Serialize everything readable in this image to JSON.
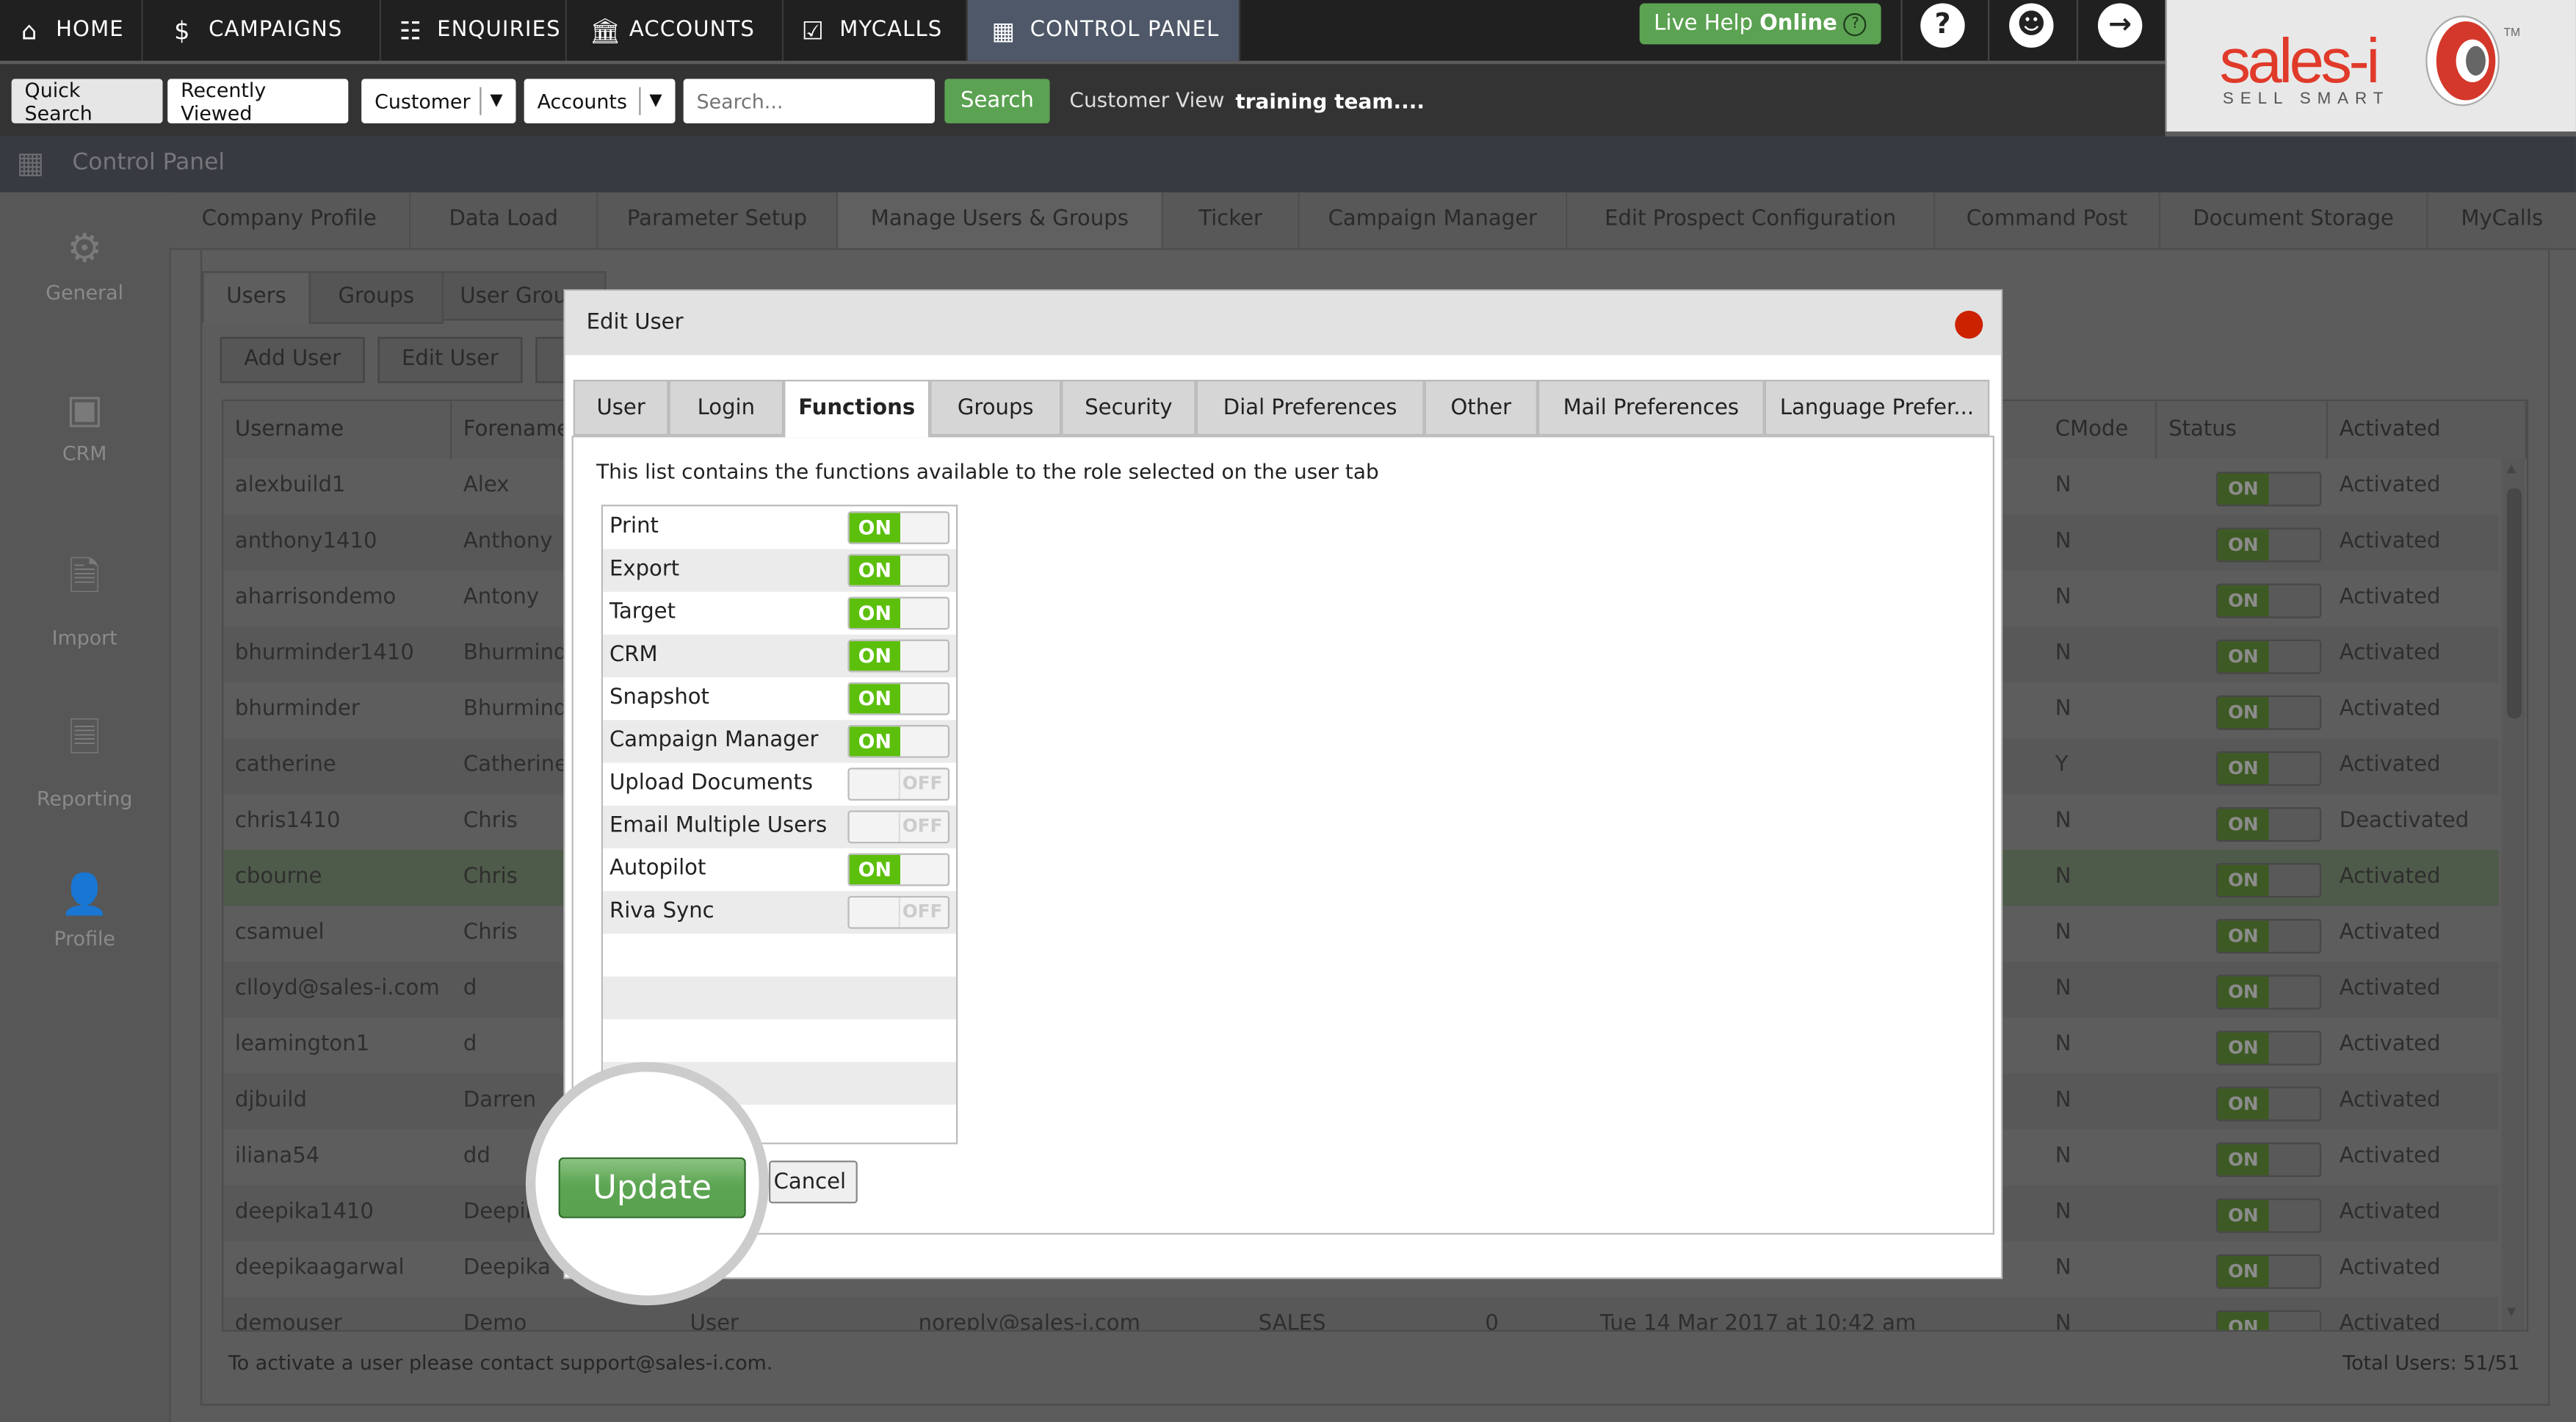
{
  "topnav": {
    "items": [
      {
        "label": "HOME",
        "icon": "home-icon"
      },
      {
        "label": "CAMPAIGNS",
        "icon": "campaigns-icon"
      },
      {
        "label": "ENQUIRIES",
        "icon": "enquiries-icon"
      },
      {
        "label": "ACCOUNTS",
        "icon": "accounts-icon"
      },
      {
        "label": "MYCALLS",
        "icon": "mycalls-icon"
      },
      {
        "label": "CONTROL PANEL",
        "icon": "control-panel-icon",
        "active": true
      }
    ],
    "live_help": "Live Help",
    "live_help_status": "Online",
    "logo_text": "sales-i",
    "logo_tagline": "SELL SMART",
    "logo_tm": "TM"
  },
  "searchbar": {
    "quick_search": "Quick Search",
    "recently_viewed": "Recently Viewed",
    "type_select": "Customer",
    "field_select": "Accounts",
    "search_placeholder": "Search...",
    "search_button": "Search",
    "customer_view_label": "Customer View",
    "customer_view_value": "training team...."
  },
  "page_title": "Control Panel",
  "sidebar": {
    "items": [
      {
        "label": "General",
        "icon": "gear-icon"
      },
      {
        "label": "CRM",
        "icon": "crm-icon"
      },
      {
        "label": "Import",
        "icon": "import-icon"
      },
      {
        "label": "Reporting",
        "icon": "reporting-icon"
      },
      {
        "label": "Profile",
        "icon": "profile-icon"
      }
    ]
  },
  "panel_tabs": [
    "Company Profile",
    "Data Load",
    "Parameter Setup",
    "Manage Users & Groups",
    "Ticker",
    "Campaign Manager",
    "Edit Prospect Configuration",
    "Command Post",
    "Document Storage",
    "MyCalls"
  ],
  "sub_tabs": [
    "Users",
    "Groups",
    "User Grou"
  ],
  "actions": {
    "add_user": "Add User",
    "edit_user": "Edit User"
  },
  "table": {
    "headers": {
      "username": "Username",
      "forename": "Forename",
      "cmode": "CMode",
      "status": "Status",
      "activated": "Activated"
    },
    "rows": [
      {
        "username": "alexbuild1",
        "forename": "Alex",
        "cmode": "N",
        "status": "ON",
        "activated": "Activated"
      },
      {
        "username": "anthony1410",
        "forename": "Anthony",
        "cmode": "N",
        "status": "ON",
        "activated": "Activated"
      },
      {
        "username": "aharrisondemo",
        "forename": "Antony",
        "cmode": "N",
        "status": "ON",
        "activated": "Activated"
      },
      {
        "username": "bhurminder1410",
        "forename": "Bhurminder",
        "cmode": "N",
        "status": "ON",
        "activated": "Activated"
      },
      {
        "username": "bhurminder",
        "forename": "Bhurminder",
        "cmode": "N",
        "status": "ON",
        "activated": "Activated"
      },
      {
        "username": "catherine",
        "forename": "Catherine",
        "cmode": "Y",
        "status": "ON",
        "activated": "Activated"
      },
      {
        "username": "chris1410",
        "forename": "Chris",
        "cmode": "N",
        "status": "ON",
        "activated": "Deactivated"
      },
      {
        "username": "cbourne",
        "forename": "Chris",
        "cmode": "N",
        "status": "ON",
        "activated": "Activated",
        "selected": true
      },
      {
        "username": "csamuel",
        "forename": "Chris",
        "cmode": "N",
        "status": "ON",
        "activated": "Activated"
      },
      {
        "username": "clloyd@sales-i.com",
        "forename": "d",
        "cmode": "N",
        "status": "ON",
        "activated": "Activated"
      },
      {
        "username": "leamington1",
        "forename": "d",
        "cmode": "N",
        "status": "ON",
        "activated": "Activated"
      },
      {
        "username": "djbuild",
        "forename": "Darren",
        "cmode": "N",
        "status": "ON",
        "activated": "Activated"
      },
      {
        "username": "iliana54",
        "forename": "dd",
        "cmode": "N",
        "status": "ON",
        "activated": "Activated"
      },
      {
        "username": "deepika1410",
        "forename": "Deepika",
        "cmode": "N",
        "status": "ON",
        "activated": "Activated"
      },
      {
        "username": "deepikaagarwal",
        "forename": "Deepika",
        "cmode": "N",
        "status": "ON",
        "activated": "Activated"
      },
      {
        "username": "demouser",
        "forename": "Demo",
        "surname": "User",
        "email": "noreply@sales-i.com",
        "role": "SALES",
        "count": "0",
        "last_login": "Tue 14 Mar 2017 at 10:42 am",
        "cmode": "N",
        "status": "ON",
        "activated": "Activated"
      }
    ]
  },
  "footer": {
    "note": "To activate a user please contact support@sales-i.com.",
    "total": "Total Users: 51/51"
  },
  "dialog": {
    "title": "Edit User",
    "tabs": [
      "User",
      "Login",
      "Functions",
      "Groups",
      "Security",
      "Dial Preferences",
      "Other",
      "Mail Preferences",
      "Language Prefer..."
    ],
    "active_tab": "Functions",
    "note": "This list contains the functions available to the role selected on the user tab",
    "on_label": "ON",
    "off_label": "OFF",
    "functions": [
      {
        "label": "Print",
        "on": true
      },
      {
        "label": "Export",
        "on": true
      },
      {
        "label": "Target",
        "on": true
      },
      {
        "label": "CRM",
        "on": true
      },
      {
        "label": "Snapshot",
        "on": true
      },
      {
        "label": "Campaign Manager",
        "on": true
      },
      {
        "label": "Upload Documents",
        "on": false
      },
      {
        "label": "Email Multiple Users",
        "on": false
      },
      {
        "label": "Autopilot",
        "on": true
      },
      {
        "label": "Riva Sync",
        "on": false
      }
    ],
    "update": "Update",
    "cancel": "Cancel"
  },
  "colors": {
    "accent_green": "#5ba252",
    "toggle_on": "#5cbf0c",
    "active_nav": "#4e5869",
    "close_red": "#cc2200",
    "logo_red": "#e03a2a"
  }
}
